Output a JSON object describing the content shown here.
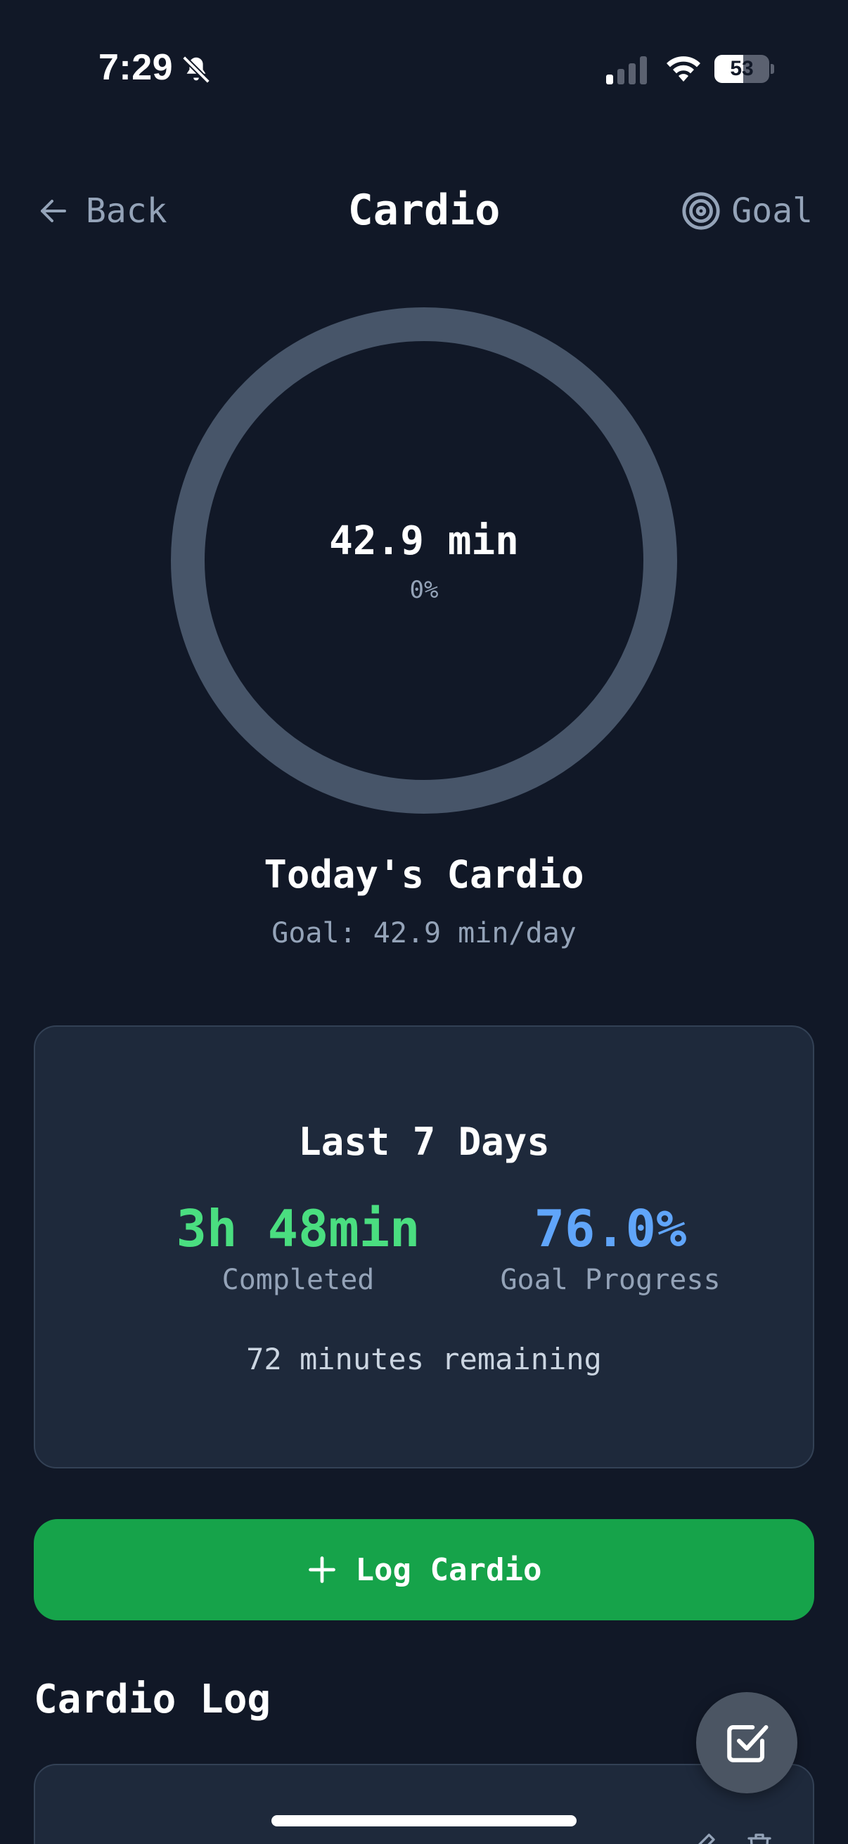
{
  "status_bar": {
    "time": "7:29",
    "battery": "53",
    "battery_level": 0.53
  },
  "nav": {
    "back_label": "Back",
    "title": "Cardio",
    "goal_label": "Goal"
  },
  "ring": {
    "value": "42.9 min",
    "percent": "0%",
    "progress": 0,
    "track_color": "#475569"
  },
  "today": {
    "title": "Today's Cardio",
    "goal": "Goal: 42.9 min/day"
  },
  "summary": {
    "title": "Last 7 Days",
    "completed_value": "3h 48min",
    "completed_label": "Completed",
    "progress_value": "76.0%",
    "progress_label": "Goal Progress",
    "remaining": "72 minutes remaining"
  },
  "actions": {
    "log_label": "Log Cardio"
  },
  "log": {
    "title": "Cardio Log"
  },
  "colors": {
    "background": "#111827",
    "card": "#1e293b",
    "accent_green": "#16a34a",
    "completed_green": "#4ade80",
    "progress_blue": "#60a5fa",
    "muted": "#94a3b8"
  },
  "icons": [
    "bell-slash-icon",
    "signal-icon",
    "wifi-icon",
    "battery-icon",
    "arrow-left-icon",
    "target-icon",
    "plus-icon",
    "edit-icon",
    "trash-icon",
    "check-square-icon"
  ]
}
